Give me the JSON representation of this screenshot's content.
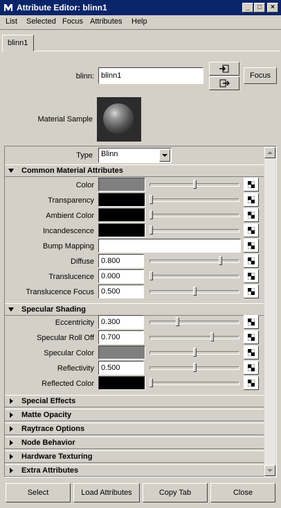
{
  "window": {
    "title": "Attribute Editor: blinn1"
  },
  "menu": [
    "List",
    "Selected",
    "Focus",
    "Attributes",
    "Help"
  ],
  "tab": {
    "label": "blinn1"
  },
  "node": {
    "type_label": "blinn:",
    "name": "blinn1",
    "focus_label": "Focus"
  },
  "material_sample": {
    "label": "Material Sample"
  },
  "type_row": {
    "label": "Type",
    "value": "Blinn"
  },
  "sections": {
    "common": "Common Material Attributes",
    "specular": "Specular Shading",
    "collapsed": [
      "Special Effects",
      "Matte Opacity",
      "Raytrace Options",
      "Node Behavior",
      "Hardware Texturing",
      "Extra Attributes"
    ]
  },
  "common_attrs": [
    {
      "label": "Color",
      "kind": "swatch",
      "color": "#808080",
      "slider": 0.5
    },
    {
      "label": "Transparency",
      "kind": "swatch",
      "color": "#000000",
      "slider": 0.0
    },
    {
      "label": "Ambient Color",
      "kind": "swatch",
      "color": "#000000",
      "slider": 0.0
    },
    {
      "label": "Incandescence",
      "kind": "swatch",
      "color": "#000000",
      "slider": 0.0
    },
    {
      "label": "Bump Mapping",
      "kind": "field",
      "value": ""
    },
    {
      "label": "Diffuse",
      "kind": "value",
      "value": "0.800",
      "slider": 0.8
    },
    {
      "label": "Translucence",
      "kind": "value",
      "value": "0.000",
      "slider": 0.0
    },
    {
      "label": "Translucence Focus",
      "kind": "value",
      "value": "0.500",
      "slider": 0.5
    }
  ],
  "specular_attrs": [
    {
      "label": "Eccentricity",
      "kind": "value",
      "value": "0.300",
      "slider": 0.3
    },
    {
      "label": "Specular Roll Off",
      "kind": "value",
      "value": "0.700",
      "slider": 0.7
    },
    {
      "label": "Specular Color",
      "kind": "swatch",
      "color": "#808080",
      "slider": 0.5
    },
    {
      "label": "Reflectivity",
      "kind": "value",
      "value": "0.500",
      "slider": 0.5
    },
    {
      "label": "Reflected Color",
      "kind": "swatch",
      "color": "#000000",
      "slider": 0.0
    }
  ],
  "bottom_buttons": [
    "Select",
    "Load Attributes",
    "Copy Tab",
    "Close"
  ]
}
